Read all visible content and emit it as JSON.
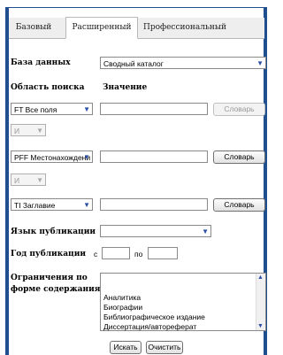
{
  "tabs": [
    {
      "label": "Базовый"
    },
    {
      "label": "Расширенный"
    },
    {
      "label": "Профессиональный"
    }
  ],
  "form": {
    "database_label": "База данных",
    "database_value": "Сводный каталог",
    "search_area_label": "Область поиска",
    "value_label": "Значение",
    "rows": [
      {
        "field": "FT Все поля",
        "button": "Словарь",
        "button_disabled": true
      },
      {
        "operator": "И"
      },
      {
        "field": "PFF Местонахождени",
        "button": "Словарь",
        "button_disabled": false
      },
      {
        "operator": "И"
      },
      {
        "field": "TI Заглавие",
        "button": "Словарь",
        "button_disabled": false
      }
    ],
    "language_label": "Язык публикации",
    "year_label": "Год публикации",
    "year_from": "с",
    "year_to": "по",
    "content_label_line1": "Ограничения по",
    "content_label_line2": "форме содержания",
    "content_options": [
      "Аналитика",
      "Биографии",
      "Библиографическое издание",
      "Диссертация/автореферат"
    ],
    "search_button": "Искать",
    "clear_button": "Очистить"
  }
}
